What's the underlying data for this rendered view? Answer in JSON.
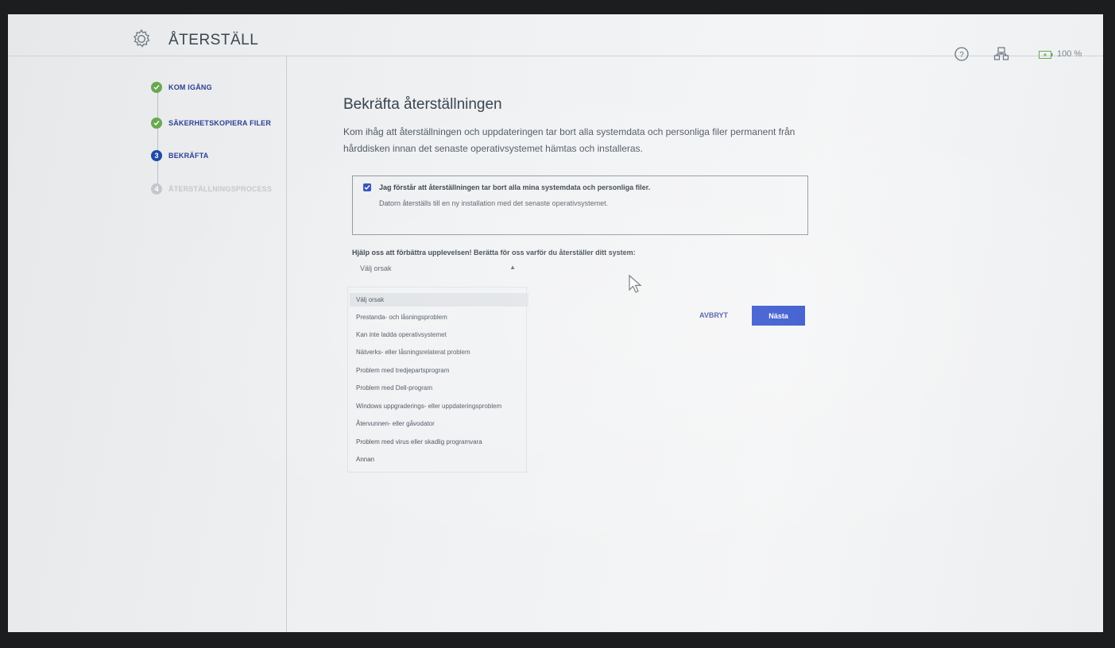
{
  "header": {
    "title": "ÅTERSTÄLL",
    "battery_label": "100 %"
  },
  "icons": {
    "app": "gear-icon",
    "help": "question-icon",
    "network": "network-icon",
    "battery": "battery-icon",
    "check": "check-icon",
    "caret": "chevron-up-icon",
    "cursor": "mouse-pointer-icon"
  },
  "colors": {
    "primary": "#1e41c8",
    "done": "#6aa84f",
    "accent_text": "#2d3f95",
    "muted": "#c3c8cd"
  },
  "steps": [
    {
      "label": "KOM IGÅNG",
      "state": "done",
      "badge": ""
    },
    {
      "label": "SÄKERHETSKOPIERA FILER",
      "state": "done",
      "badge": ""
    },
    {
      "label": "BEKRÄFTA",
      "state": "current",
      "badge": "3"
    },
    {
      "label": "ÅTERSTÄLLNINGSPROCESS",
      "state": "pending",
      "badge": "4"
    }
  ],
  "main": {
    "title": "Bekräfta återställningen",
    "description": "Kom ihåg att återställningen och uppdateringen tar bort alla systemdata och personliga filer permanent från hårddisken innan det senaste operativsystemet hämtas och installeras.",
    "confirm": {
      "checked": true,
      "label": "Jag förstår att återställningen tar bort alla mina systemdata och personliga filer.",
      "sublabel": "Datorn återställs till en ny installation med det senaste operativsystemet."
    },
    "help_text": "Hjälp oss att förbättra upplevelsen! Berätta för oss varför du återställer ditt system:",
    "select": {
      "value": "Välj orsak",
      "options": [
        "Välj orsak",
        "Prestanda- och låsningsproblem",
        "Kan inte ladda operativsystemet",
        "Nätverks- eller låsningsrelaterat problem",
        "Problem med tredjepartsprogram",
        "Problem med Dell-program",
        "Windows uppgraderings- eller uppdateringsproblem",
        "Återvunnen- eller gåvodator",
        "Problem med virus eller skadlig programvara",
        "Annan"
      ]
    },
    "buttons": {
      "cancel": "AVBRYT",
      "next": "Nästa"
    }
  }
}
